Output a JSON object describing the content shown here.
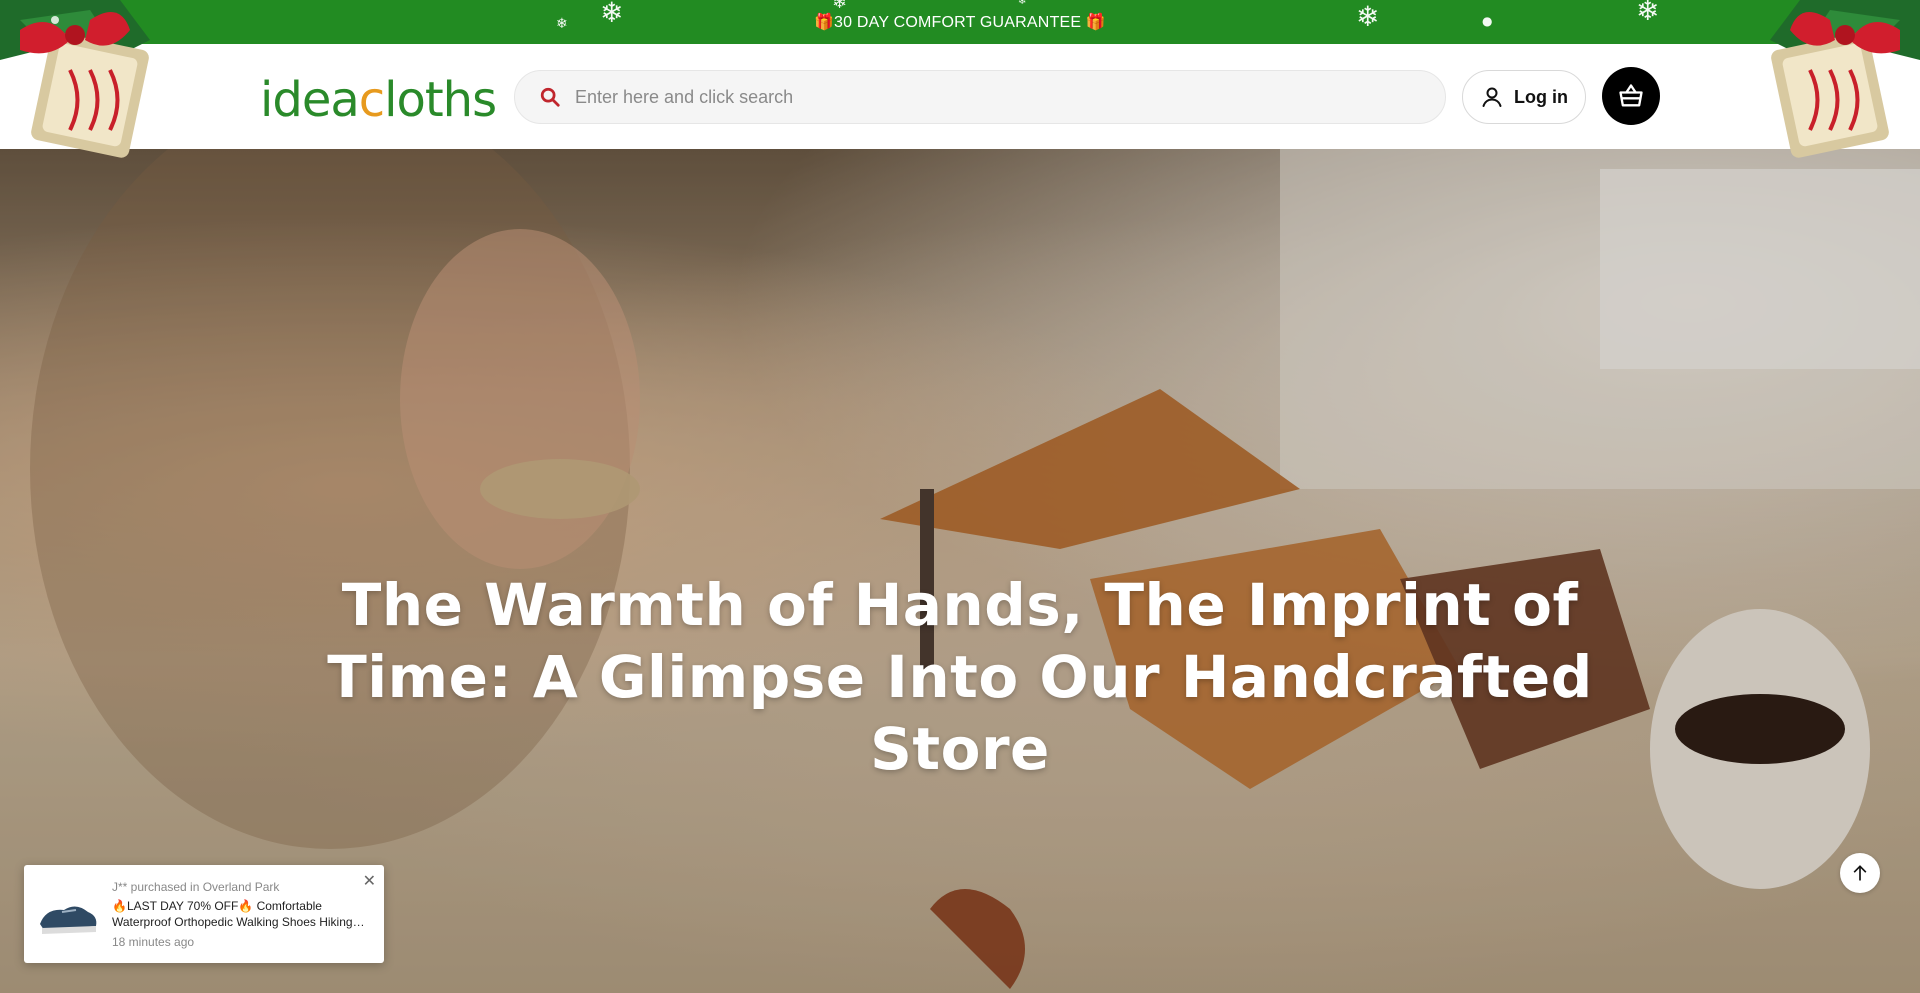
{
  "announcement": {
    "text": "🎁30 DAY COMFORT GUARANTEE 🎁"
  },
  "header": {
    "logo_text_pre": "i",
    "logo_text_mid": "dea",
    "logo_text_accent": "c",
    "logo_text_post": "loths",
    "search_placeholder": "Enter here and click search",
    "login_label": "Log in"
  },
  "hero": {
    "title": "The Warmth of Hands, The Imprint of Time: A Glimpse Into Our Handcrafted Store"
  },
  "purchase_popup": {
    "who": "J** purchased in Overland Park",
    "product": "🔥LAST DAY 70% OFF🔥 Comfortable Waterproof Orthopedic Walking Shoes Hiking Shoes",
    "time": "18 minutes ago"
  },
  "colors": {
    "announcement_bg": "#228b22",
    "logo_green": "#2a8a2a",
    "search_icon": "#c0262d",
    "cart_bg": "#000000"
  },
  "icons": [
    "search-icon",
    "user-icon",
    "basket-icon",
    "close-icon",
    "arrow-up-icon",
    "snowflake-icon",
    "christmas-bell-decoration"
  ]
}
